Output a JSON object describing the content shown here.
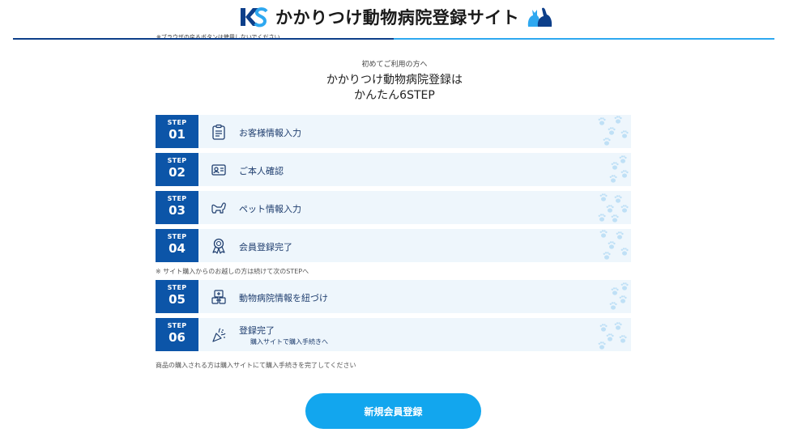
{
  "header": {
    "site_title": "かかりつけ動物病院登録サイト",
    "browser_note": "※ブラウザの戻るボタンは使用しないでください",
    "colors": {
      "navy": "#0d3f8a",
      "sky": "#2ea8f0"
    }
  },
  "intro": {
    "small": "初めてご利用の方へ",
    "line1": "かかりつけ動物病院登録は",
    "line2": "かんたん6STEP"
  },
  "steps": [
    {
      "label": "STEP",
      "number": "01",
      "title": "お客様情報入力",
      "icon": "clipboard-icon"
    },
    {
      "label": "STEP",
      "number": "02",
      "title": "ご本人確認",
      "icon": "id-card-icon"
    },
    {
      "label": "STEP",
      "number": "03",
      "title": "ペット情報入力",
      "icon": "dog-icon"
    },
    {
      "label": "STEP",
      "number": "04",
      "title": "会員登録完了",
      "icon": "award-ribbon-icon"
    },
    {
      "label": "STEP",
      "number": "05",
      "title": "動物病院情報を紐づけ",
      "icon": "clinic-link-icon"
    },
    {
      "label": "STEP",
      "number": "06",
      "title": "登録完了",
      "subtitle": "購入サイトで購入手続きへ",
      "icon": "party-popper-icon"
    }
  ],
  "mid_note": "※ サイト購入からのお越しの方は続けて次のSTEPへ",
  "bottom_note": "商品の購入される方は購入サイトにて購入手続きを完了してください",
  "cta": {
    "label": "新規会員登録",
    "color": "#12a6ee"
  },
  "badge_color": "#0c55a8"
}
